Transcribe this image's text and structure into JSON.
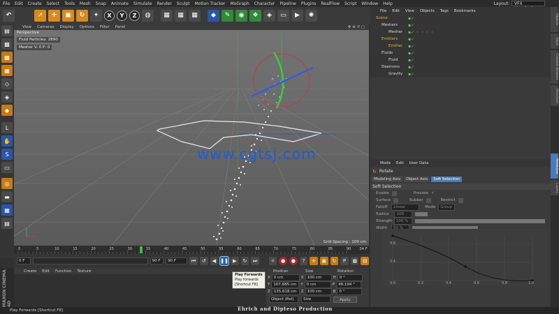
{
  "menubar": {
    "items": [
      "File",
      "Edit",
      "Create",
      "Select",
      "Tools",
      "Mesh",
      "Snap",
      "Animate",
      "Simulate",
      "Render",
      "Sculpt",
      "Motion Tracker",
      "MoGraph",
      "Character",
      "Pipeline",
      "Plugins",
      "RealFlow",
      "Script",
      "Window",
      "Help"
    ],
    "layout_label": "Layout:",
    "layout_value": "VFX standard (User)"
  },
  "toolbar": {
    "axis_x": "X",
    "axis_y": "Y",
    "axis_z": "Z"
  },
  "viewport": {
    "menu": [
      "View",
      "Cameras",
      "Display",
      "Options",
      "Filter",
      "Panel"
    ],
    "camera_label": "Perspective",
    "hud_particles": "Fluid Particles: 2890",
    "hud_mesher": "Mesher V: 0 P: 0",
    "grid_spacing": "Grid Spacing : 100 cm",
    "watermark": "www.cgtsj.com"
  },
  "timeline": {
    "ticks": [
      "0",
      "5",
      "10",
      "15",
      "20",
      "25",
      "30",
      "35",
      "40",
      "45",
      "50",
      "55",
      "60",
      "65",
      "70",
      "75",
      "80",
      "85",
      "90"
    ],
    "end_label": "34 F",
    "current_frame": 34
  },
  "transport": {
    "start_field": "0 F",
    "current_field": "0 F",
    "end_field": "90 F",
    "max_field": "90 F"
  },
  "material_panel": {
    "menu": [
      "Create",
      "Edit",
      "Function",
      "Texture"
    ]
  },
  "maxon_logo": "MAXON CINEMA 4D",
  "coordinates": {
    "headers": [
      "Position",
      "Size",
      "Rotation"
    ],
    "rows": [
      {
        "axis": "X",
        "pos": "0 cm",
        "size_axis": "X",
        "size": "100 cm",
        "rot_axis": "H",
        "rot": "0 °"
      },
      {
        "axis": "Y",
        "pos": "167.685 cm",
        "size_axis": "Y",
        "size": "0 cm",
        "rot_axis": "P",
        "rot": "48.194 °"
      },
      {
        "axis": "Z",
        "pos": "135.618 cm",
        "size_axis": "Z",
        "size": "100 cm",
        "rot_axis": "B",
        "rot": "0 °"
      }
    ],
    "mode_select": "Object (Rel)",
    "size_select": "Size",
    "apply_label": "Apply"
  },
  "tooltip": {
    "title": "Play Forwards",
    "line1": "Play forwards",
    "line2": "[Shortcut F8]"
  },
  "credit": "Ehrich   and   Dipteso  Production",
  "statusbar": "Play Forwards [Shortcut F8]",
  "object_manager": {
    "menu": [
      "File",
      "Edit",
      "View",
      "Objects",
      "Tags",
      "Bookmarks"
    ],
    "objects": [
      {
        "name": "Scene",
        "indent": 0,
        "color": "orange"
      },
      {
        "name": "Meshers",
        "indent": 1,
        "color": "normal"
      },
      {
        "name": "Mesher",
        "indent": 2,
        "color": "normal"
      },
      {
        "name": "Emitters",
        "indent": 1,
        "color": "orange"
      },
      {
        "name": "Emitter",
        "indent": 2,
        "color": "orange"
      },
      {
        "name": "Fluids",
        "indent": 1,
        "color": "normal"
      },
      {
        "name": "Fluid",
        "indent": 2,
        "color": "normal"
      },
      {
        "name": "Daemons",
        "indent": 1,
        "color": "normal"
      },
      {
        "name": "Gravity",
        "indent": 2,
        "color": "normal"
      }
    ]
  },
  "attributes": {
    "menu": [
      "Mode",
      "Edit",
      "User Data"
    ],
    "title": "Rotate",
    "tabs": [
      "Modeling Axis",
      "Object Axis",
      "Soft Selection"
    ],
    "active_tab": "Soft Selection",
    "section": "Soft Selection",
    "enable_label": "Enable",
    "preview_label": "Preview",
    "surface_label": "Surface",
    "rubber_label": "Rubber",
    "restrict_label": "Restrict",
    "falloff_label": "Falloff",
    "falloff_value": "Linear",
    "mode_label": "Mode",
    "mode_value": "Group",
    "radius_label": "Radius",
    "radius_value": "100 cm",
    "strength_label": "Strength",
    "strength_value": "100 %",
    "width_label": "Width",
    "width_value": "50 %",
    "graph_y_labels": [
      "0.8",
      "0.4"
    ],
    "graph_x_labels": [
      "0.0",
      "0.2",
      "0.4",
      "0.6",
      "0.8",
      "1.0"
    ]
  },
  "side_tabs": [
    "Objects",
    "Takes",
    "Content Browser",
    "Structure",
    "Attributes",
    "Layers"
  ]
}
